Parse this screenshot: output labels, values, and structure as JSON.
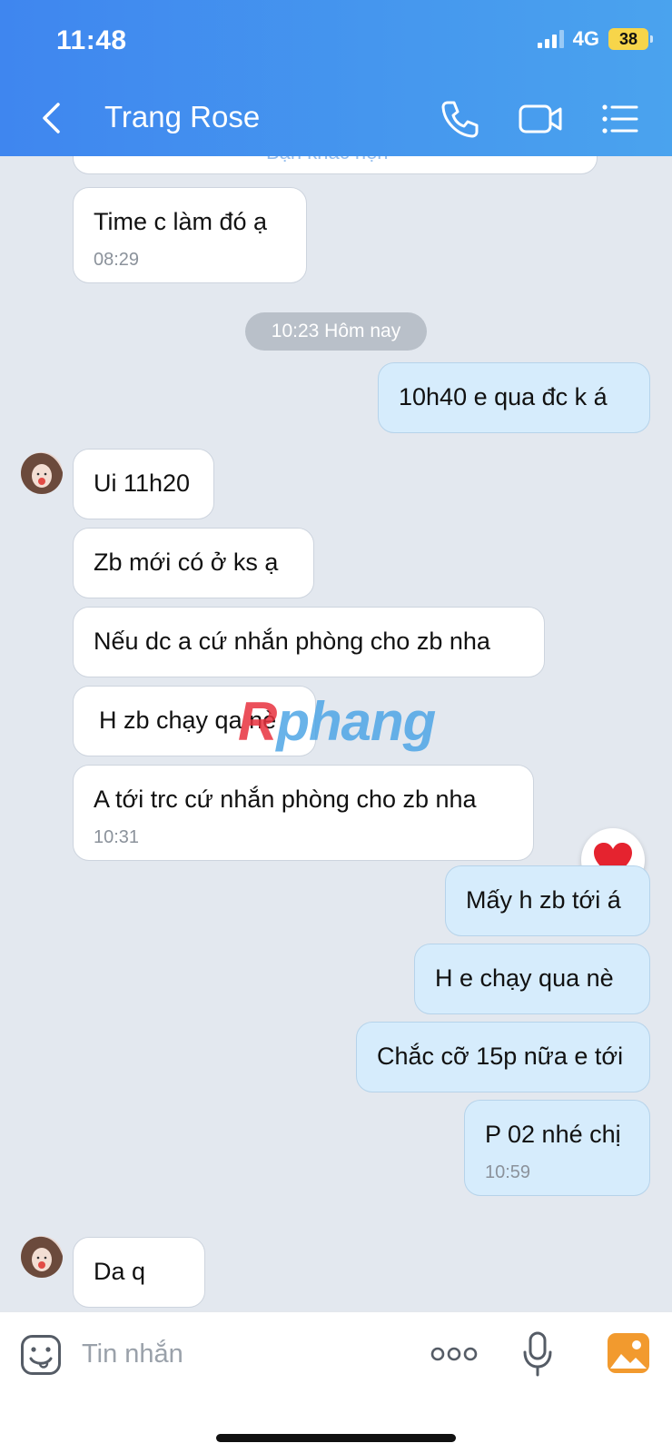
{
  "status_bar": {
    "time": "11:48",
    "network": "4G",
    "battery": "38"
  },
  "header": {
    "title": "Trang Rose"
  },
  "chat": {
    "partial_bubble_text": "Bạn khác hẹn",
    "messages": [
      {
        "text": "Time c làm đó ạ",
        "time": "08:29"
      },
      {
        "text": "10h40 e qua đc k á"
      },
      {
        "text": "Ui 11h20"
      },
      {
        "text": "Zb mới có ở ks ạ"
      },
      {
        "text": "Nếu dc a cứ nhắn phòng cho zb nha"
      },
      {
        "text": "H zb chạy qa nè"
      },
      {
        "text": "A tới trc cứ nhắn phòng cho zb nha",
        "time": "10:31"
      },
      {
        "text": "Mấy h zb tới á"
      },
      {
        "text": "H e chạy qua nè"
      },
      {
        "text": "Chắc cỡ 15p nữa e tới"
      },
      {
        "text": "P 02 nhé chị",
        "time": "10:59"
      },
      {
        "text": "Da q"
      }
    ],
    "date_separator": "10:23 Hôm nay",
    "reaction": "heart-icon",
    "watermark": {
      "part1": "R",
      "part2": "phang"
    }
  },
  "composer": {
    "placeholder": "Tin nhắn"
  },
  "colors": {
    "header_start": "#3f86ef",
    "header_end": "#4aa3ee",
    "outgoing_bubble": "#d6ecfc",
    "incoming_bubble": "#ffffff",
    "chat_bg": "#e3e8ef"
  }
}
